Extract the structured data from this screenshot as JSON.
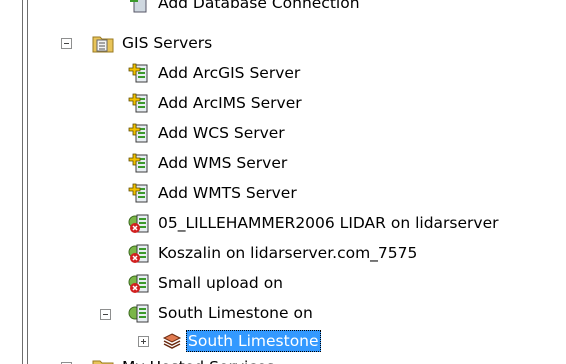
{
  "tree": {
    "items": [
      {
        "label": "Add Database Connection"
      },
      {
        "label": "GIS Servers"
      },
      {
        "label": "Add ArcGIS Server"
      },
      {
        "label": "Add ArcIMS Server"
      },
      {
        "label": "Add WCS Server"
      },
      {
        "label": "Add WMS Server"
      },
      {
        "label": "Add WMTS Server"
      },
      {
        "label": "05_LILLEHAMMER2006 LIDAR on lidarserver"
      },
      {
        "label": "Koszalin on lidarserver.com_7575"
      },
      {
        "label": "Small upload on"
      },
      {
        "label": "South Limestone on"
      },
      {
        "label": "South Limestone"
      },
      {
        "label": "My Hosted Services"
      }
    ]
  },
  "icons": {
    "folder": "folder-icon",
    "add_server": "add-server-icon",
    "server_disconnected": "server-disconnected-icon",
    "server_connected": "server-connected-icon",
    "layers": "layers-icon"
  },
  "colors": {
    "selection": "#3399ff",
    "server_green": "#3c9a2c",
    "error_red": "#d22020",
    "folder_yellow": "#e8c45a"
  }
}
